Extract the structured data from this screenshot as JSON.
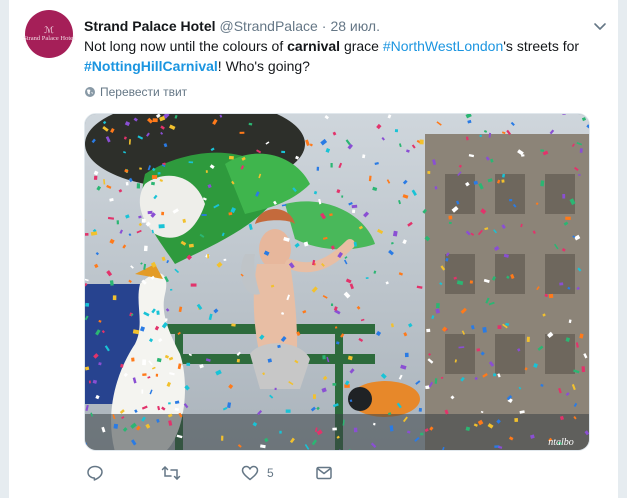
{
  "tweet": {
    "avatar": {
      "monogram": "ℳ",
      "wordmark": "Strand Palace Hotel"
    },
    "author_name": "Strand Palace Hotel",
    "handle": "@StrandPalace",
    "separator": "·",
    "date": "28 июл.",
    "text": {
      "p1": "Not long now until the colours of ",
      "bold": "carnival",
      "p2": " grace ",
      "hashtag1": "#NorthWestLondon",
      "p3": "'s streets for",
      "hashtag2": "#NottingHillCarnival",
      "p4": "! Who's going?"
    },
    "translate_label": "Перевести твит",
    "media_watermark": "ntalbo",
    "actions": {
      "like_count": "5"
    },
    "colors": {
      "link": "#1b95e0",
      "muted": "#657786",
      "avatar_bg": "#a51f58"
    }
  }
}
